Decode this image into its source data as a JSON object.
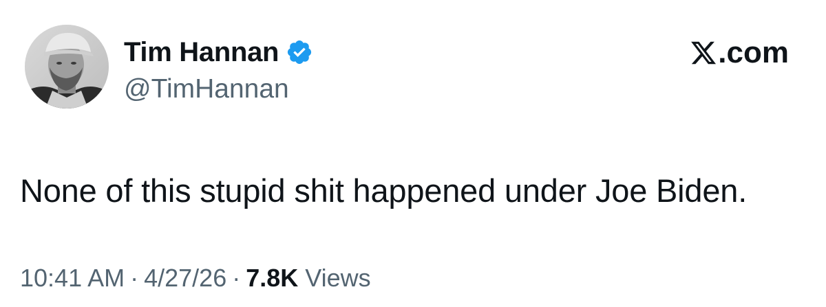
{
  "author": {
    "display_name": "Tim Hannan",
    "handle": "@TimHannan",
    "verified_icon": "verified-badge-icon",
    "avatar_description": "profile-photo"
  },
  "brand": {
    "logo_icon": "x-logo-icon",
    "suffix": ".com"
  },
  "tweet": {
    "text": "None of this stupid shit happened under Joe Biden."
  },
  "meta": {
    "time": "10:41 AM",
    "date": "4/27/26",
    "separator": "·",
    "views_count": "7.8K",
    "views_label": "Views"
  },
  "colors": {
    "text_primary": "#0f1419",
    "text_secondary": "#536471",
    "verified_blue": "#1d9bf0",
    "background": "#ffffff"
  }
}
